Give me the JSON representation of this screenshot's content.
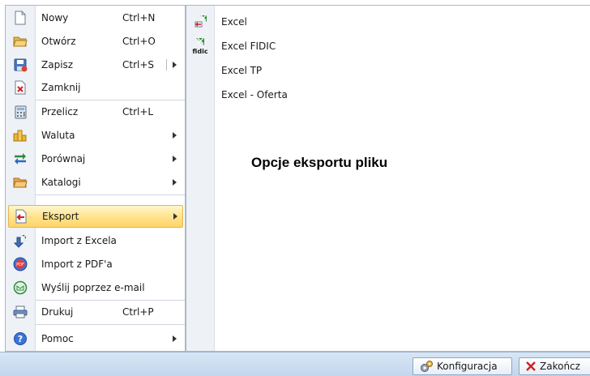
{
  "menu": {
    "items": [
      {
        "label": "Nowy",
        "shortcut": "Ctrl+N",
        "icon": "new-document-icon"
      },
      {
        "label": "Otwórz",
        "shortcut": "Ctrl+O",
        "icon": "open-folder-icon"
      },
      {
        "label": "Zapisz",
        "shortcut": "Ctrl+S",
        "icon": "save-icon"
      },
      {
        "label": "Zamknij",
        "shortcut": "",
        "icon": "close-document-icon"
      },
      {
        "label": "Przelicz",
        "shortcut": "Ctrl+L",
        "icon": "calculator-icon"
      },
      {
        "label": "Waluta",
        "shortcut": "",
        "icon": "coins-icon"
      },
      {
        "label": "Porównaj",
        "shortcut": "",
        "icon": "compare-arrows-icon"
      },
      {
        "label": "Katalogi",
        "shortcut": "",
        "icon": "catalog-folder-icon"
      },
      {
        "label": "Eksport",
        "shortcut": "",
        "icon": "export-icon"
      },
      {
        "label": "Import z Excela",
        "shortcut": "",
        "icon": "import-excel-icon"
      },
      {
        "label": "Import z PDF'a",
        "shortcut": "",
        "icon": "import-pdf-icon"
      },
      {
        "label": "Wyślij poprzez e-mail",
        "shortcut": "",
        "icon": "email-icon"
      },
      {
        "label": "Drukuj",
        "shortcut": "Ctrl+P",
        "icon": "printer-icon"
      },
      {
        "label": "Pomoc",
        "shortcut": "",
        "icon": "help-icon"
      }
    ],
    "active_item": "Eksport"
  },
  "submenu": {
    "items": [
      {
        "label": "Excel",
        "icon": "excel-export-icon"
      },
      {
        "label": "Excel FIDIC",
        "icon": "fidic-icon"
      },
      {
        "label": "Excel TP",
        "icon": ""
      },
      {
        "label": "Excel - Oferta",
        "icon": ""
      }
    ],
    "title": "Opcje eksportu pliku",
    "fidic_icon_text": "fidic"
  },
  "bottombar": {
    "config_label": "Konfiguracja",
    "exit_label": "Zakończ"
  },
  "colors": {
    "highlight": "#ffe28a",
    "excel_green": "#2e8b3a",
    "exit_red": "#d02020"
  }
}
